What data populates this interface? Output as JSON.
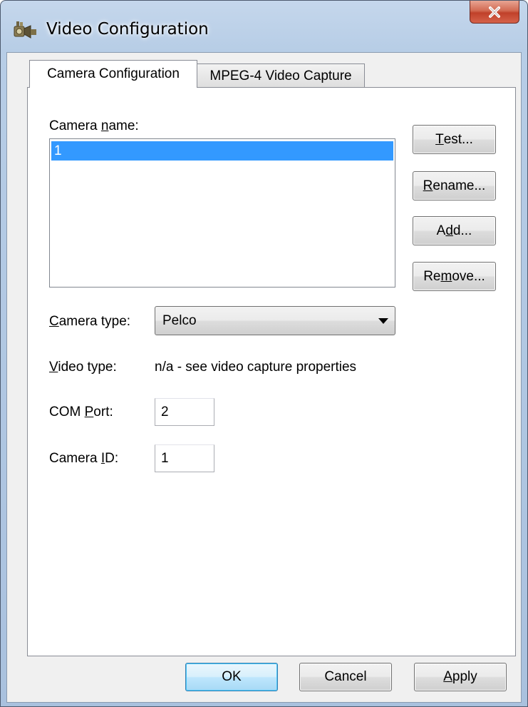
{
  "window": {
    "title": "Video Configuration"
  },
  "tabs": [
    {
      "label": "Camera Configuration",
      "selected": true
    },
    {
      "label": "MPEG-4 Video Capture",
      "selected": false
    }
  ],
  "camera_config": {
    "camera_name": {
      "pre": "Camera ",
      "key": "n",
      "post": "ame:"
    },
    "camera_list": [
      "1"
    ],
    "selected_camera": "1",
    "buttons": {
      "test": {
        "pre": "",
        "key": "T",
        "post": "est..."
      },
      "rename": {
        "pre": "",
        "key": "R",
        "post": "ename..."
      },
      "add": {
        "pre": "A",
        "key": "d",
        "post": "d..."
      },
      "remove": {
        "pre": "Re",
        "key": "m",
        "post": "ove..."
      }
    },
    "camera_type": {
      "label": {
        "pre": "",
        "key": "C",
        "post": "amera type:"
      },
      "value": "Pelco"
    },
    "video_type": {
      "label": {
        "pre": "",
        "key": "V",
        "post": "ideo type:"
      },
      "value": "n/a - see video capture properties"
    },
    "com_port": {
      "label": {
        "pre": "COM ",
        "key": "P",
        "post": "ort:"
      },
      "value": "2"
    },
    "camera_id": {
      "label": {
        "pre": "Camera ",
        "key": "I",
        "post": "D:"
      },
      "value": "1"
    }
  },
  "dialog_buttons": {
    "ok": "OK",
    "cancel": "Cancel",
    "apply": {
      "pre": "",
      "key": "A",
      "post": "pply"
    }
  },
  "colors": {
    "selection": "#3399ff",
    "close_button": "#c0412a",
    "default_button_border": "#3c7fb1"
  }
}
